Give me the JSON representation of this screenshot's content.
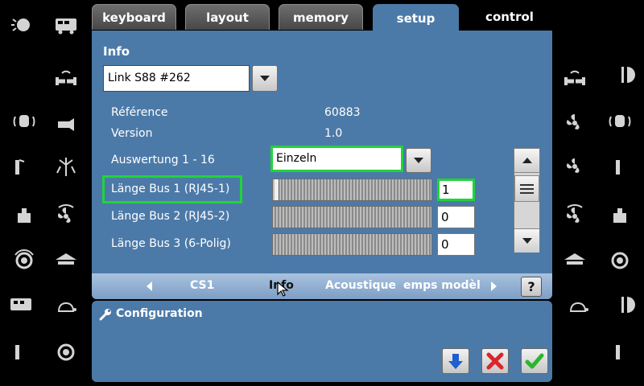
{
  "tabs": [
    {
      "label": "keyboard",
      "state": "inactive"
    },
    {
      "label": "layout",
      "state": "inactive"
    },
    {
      "label": "memory",
      "state": "inactive"
    },
    {
      "label": "setup",
      "state": "active"
    },
    {
      "label": "control",
      "state": "plain"
    }
  ],
  "info": {
    "title": "Info",
    "device_select": "Link S88 #262",
    "reference_label": "Référence",
    "reference_value": "60883",
    "version_label": "Version",
    "version_value": "1.0",
    "evaluation_label": "Auswertung 1 - 16",
    "evaluation_value": "Einzeln",
    "bus1_label": "Länge Bus 1 (RJ45-1)",
    "bus1_value": "1",
    "bus2_label": "Länge Bus 2 (RJ45-2)",
    "bus2_value": "0",
    "bus3_label": "Länge Bus 3 (6-Polig)",
    "bus3_value": "0"
  },
  "subnav": {
    "item1": "CS1",
    "item2": "Info",
    "item3": "Acoustique",
    "item4": "emps modèl",
    "help": "?"
  },
  "config": {
    "title": "Configuration"
  },
  "colors": {
    "panel": "#4c7aa8",
    "highlight": "#21d33a",
    "confirm": "#2db52d",
    "cancel": "#d9262b",
    "download": "#1f5fcf"
  },
  "side_icons_left": [
    "light-icon",
    "locomotive-icon",
    "coupling-icon",
    "cab-signal-icon",
    "horn-icon",
    "pantograph-icon",
    "smoke-icon",
    "ventilator-icon",
    "crane-icon",
    "bell-icon",
    "vault-icon",
    "rail-icon",
    "turtle-icon",
    "bell-ring-icon"
  ],
  "side_icons_right": [
    "coupling-icon",
    "light-half-icon",
    "ventilator-icon",
    "cab-signal-icon",
    "ventilator-icon",
    "pantograph-icon",
    "ventilator-icon",
    "crane-icon",
    "vault-icon",
    "bell-ring-icon",
    "turtle-icon",
    "light-half-icon",
    "rail-icon"
  ]
}
